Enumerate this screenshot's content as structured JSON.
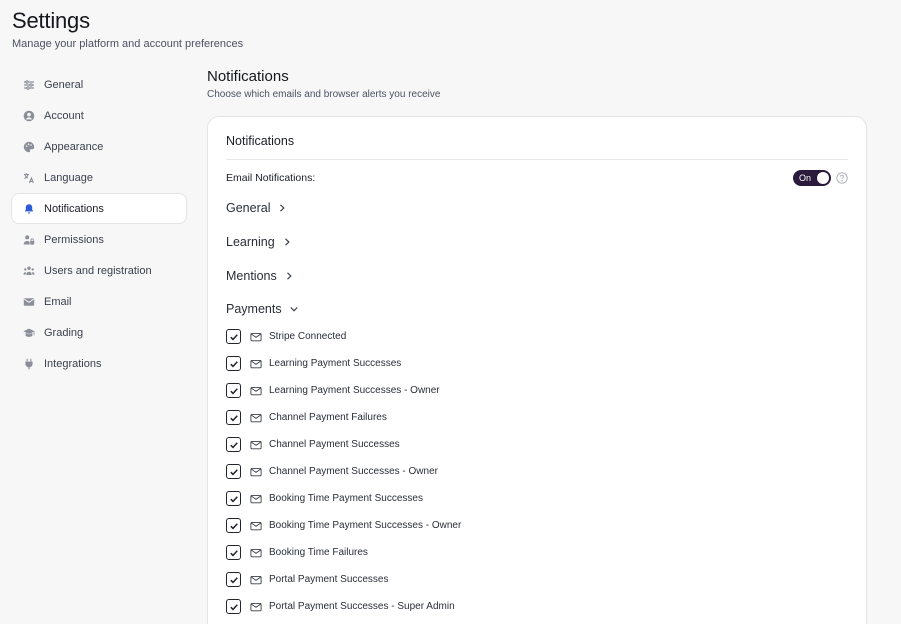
{
  "header": {
    "title": "Settings",
    "subtitle": "Manage your platform and account preferences"
  },
  "sidebar": {
    "items": [
      {
        "label": "General",
        "icon": "sliders-icon",
        "active": false
      },
      {
        "label": "Account",
        "icon": "user-circle-icon",
        "active": false
      },
      {
        "label": "Appearance",
        "icon": "palette-icon",
        "active": false
      },
      {
        "label": "Language",
        "icon": "translate-icon",
        "active": false
      },
      {
        "label": "Notifications",
        "icon": "bell-icon",
        "active": true
      },
      {
        "label": "Permissions",
        "icon": "user-lock-icon",
        "active": false
      },
      {
        "label": "Users and registration",
        "icon": "users-icon",
        "active": false
      },
      {
        "label": "Email",
        "icon": "envelope-icon",
        "active": false
      },
      {
        "label": "Grading",
        "icon": "graduation-cap-icon",
        "active": false
      },
      {
        "label": "Integrations",
        "icon": "plug-icon",
        "active": false
      }
    ]
  },
  "main": {
    "title": "Notifications",
    "description": "Choose which emails and browser alerts you receive"
  },
  "card": {
    "title": "Notifications",
    "email_notifications": {
      "label": "Email Notifications:",
      "toggle_text": "On",
      "enabled": true
    },
    "groups": [
      {
        "label": "General",
        "expanded": false
      },
      {
        "label": "Learning",
        "expanded": false
      },
      {
        "label": "Mentions",
        "expanded": false
      },
      {
        "label": "Payments",
        "expanded": true
      }
    ],
    "payment_items": [
      {
        "label": "Stripe Connected",
        "checked": true
      },
      {
        "label": "Learning Payment Successes",
        "checked": true
      },
      {
        "label": "Learning Payment Successes - Owner",
        "checked": true
      },
      {
        "label": "Channel Payment Failures",
        "checked": true
      },
      {
        "label": "Channel Payment Successes",
        "checked": true
      },
      {
        "label": "Channel Payment Successes - Owner",
        "checked": true
      },
      {
        "label": "Booking Time Payment Successes",
        "checked": true
      },
      {
        "label": "Booking Time Payment Successes - Owner",
        "checked": true
      },
      {
        "label": "Booking Time Failures",
        "checked": true
      },
      {
        "label": "Portal Payment Successes",
        "checked": true
      },
      {
        "label": "Portal Payment Successes - Super Admin",
        "checked": true
      }
    ]
  },
  "colors": {
    "background": "#f7f7f8",
    "toggle_on": "#2a1a3c",
    "icon_gray": "#8a8f99"
  }
}
